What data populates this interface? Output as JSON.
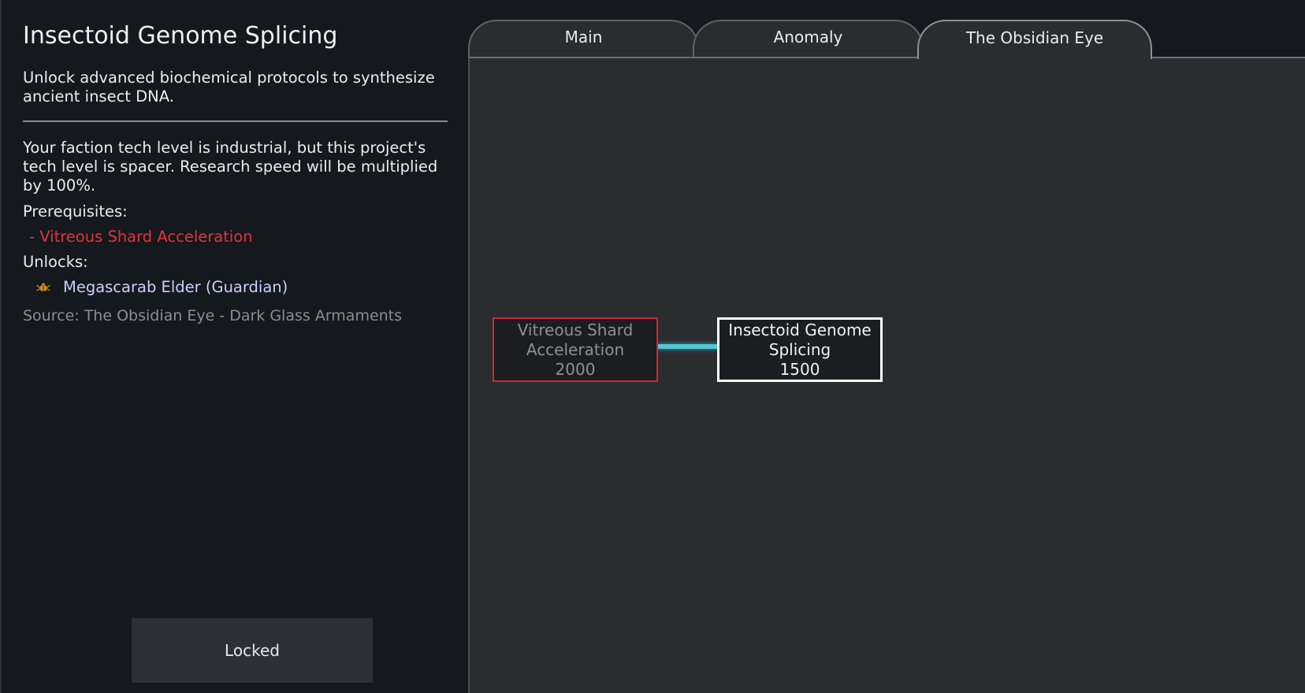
{
  "detail": {
    "title": "Insectoid Genome Splicing",
    "description": "Unlock advanced biochemical protocols to synthesize ancient insect DNA.",
    "tech_note": "Your faction tech level is industrial, but this project's tech level is spacer. Research speed will be multiplied by 100%.",
    "prerequisites_label": "Prerequisites:",
    "prerequisites": [
      "- Vitreous Shard Acceleration"
    ],
    "unlocks_label": "Unlocks:",
    "unlocks": [
      {
        "label": "Megascarab Elder (Guardian)",
        "icon": "insect-icon"
      }
    ],
    "source": "Source:  The Obsidian Eye - Dark Glass Armaments",
    "action_button": "Locked"
  },
  "tabs": [
    {
      "label": "Main",
      "active": false
    },
    {
      "label": "Anomaly",
      "active": false
    },
    {
      "label": "The Obsidian Eye",
      "active": true
    }
  ],
  "tree": {
    "nodes": [
      {
        "name": "Vitreous Shard Acceleration",
        "line1": "Vitreous Shard",
        "line2": "Acceleration",
        "cost": "2000",
        "state": "locked-prerequisite"
      },
      {
        "name": "Insectoid Genome Splicing",
        "line1": "Insectoid Genome",
        "line2": "Splicing",
        "cost": "1500",
        "state": "selected"
      }
    ]
  },
  "colors": {
    "background": "#15181d",
    "panel": "#2b2c2e",
    "prerequisite_red": "#e0363a",
    "unlock_link": "#c8d2ff",
    "connector_cyan": "#54c7d6",
    "muted_text": "#8b8e93"
  }
}
